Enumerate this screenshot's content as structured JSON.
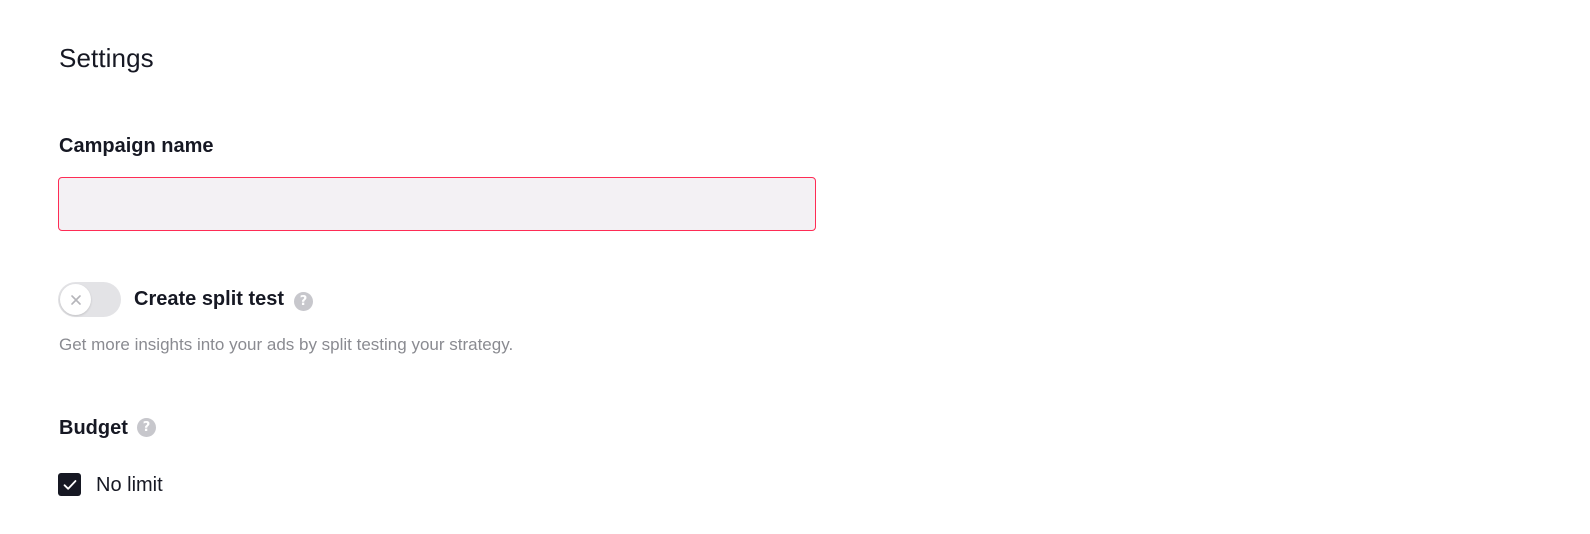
{
  "settings": {
    "title": "Settings"
  },
  "campaign_name": {
    "label": "Campaign name",
    "value": "",
    "placeholder": ""
  },
  "split_test": {
    "label": "Create split test",
    "enabled": false,
    "description": "Get more insights into your ads by split testing your strategy.",
    "help_icon": "question-mark-icon",
    "help_glyph": "?"
  },
  "budget": {
    "label": "Budget",
    "help_icon": "question-mark-icon",
    "help_glyph": "?",
    "no_limit": {
      "label": "No limit",
      "checked": true
    }
  },
  "colors": {
    "accent": "#fe2c55",
    "text": "#161823",
    "hint": "#8a8b91",
    "input_bg": "#f3f1f4",
    "toggle_off": "#e3e3e6"
  }
}
